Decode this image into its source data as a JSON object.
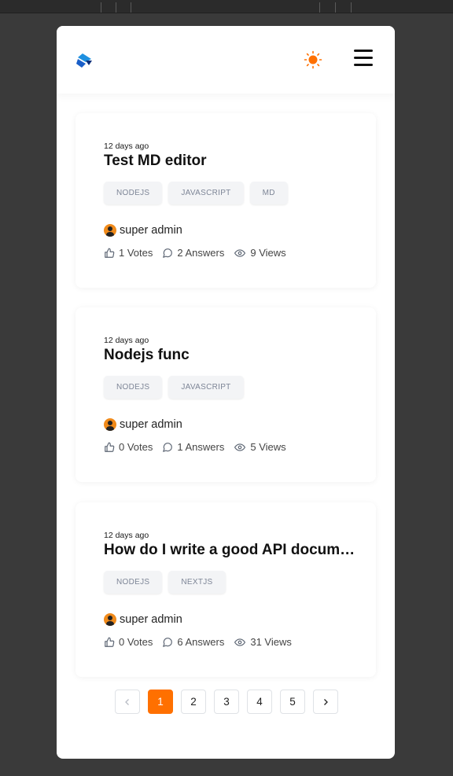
{
  "header": {
    "logo_icon": "stack-logo-icon",
    "theme_icon": "sun-icon",
    "menu_icon": "hamburger-menu-icon",
    "accent": "#ff7000"
  },
  "questions": [
    {
      "time": "12 days ago",
      "title": "Test MD editor",
      "tags": [
        "NODEJS",
        "JAVASCRIPT",
        "MD"
      ],
      "author": "super admin",
      "votes": "1 Votes",
      "answers": "2 Answers",
      "views": "9 Views"
    },
    {
      "time": "12 days ago",
      "title": "Nodejs func",
      "tags": [
        "NODEJS",
        "JAVASCRIPT"
      ],
      "author": "super admin",
      "votes": "0 Votes",
      "answers": "1 Answers",
      "views": "5 Views"
    },
    {
      "time": "12 days ago",
      "title": "How do I write a good API documentation?",
      "tags": [
        "NODEJS",
        "NEXTJS"
      ],
      "author": "super admin",
      "votes": "0 Votes",
      "answers": "6 Answers",
      "views": "31 Views"
    }
  ],
  "pagination": {
    "prev_icon": "chevron-left-icon",
    "next_icon": "chevron-right-icon",
    "pages": [
      "1",
      "2",
      "3",
      "4",
      "5"
    ],
    "current": "1"
  }
}
